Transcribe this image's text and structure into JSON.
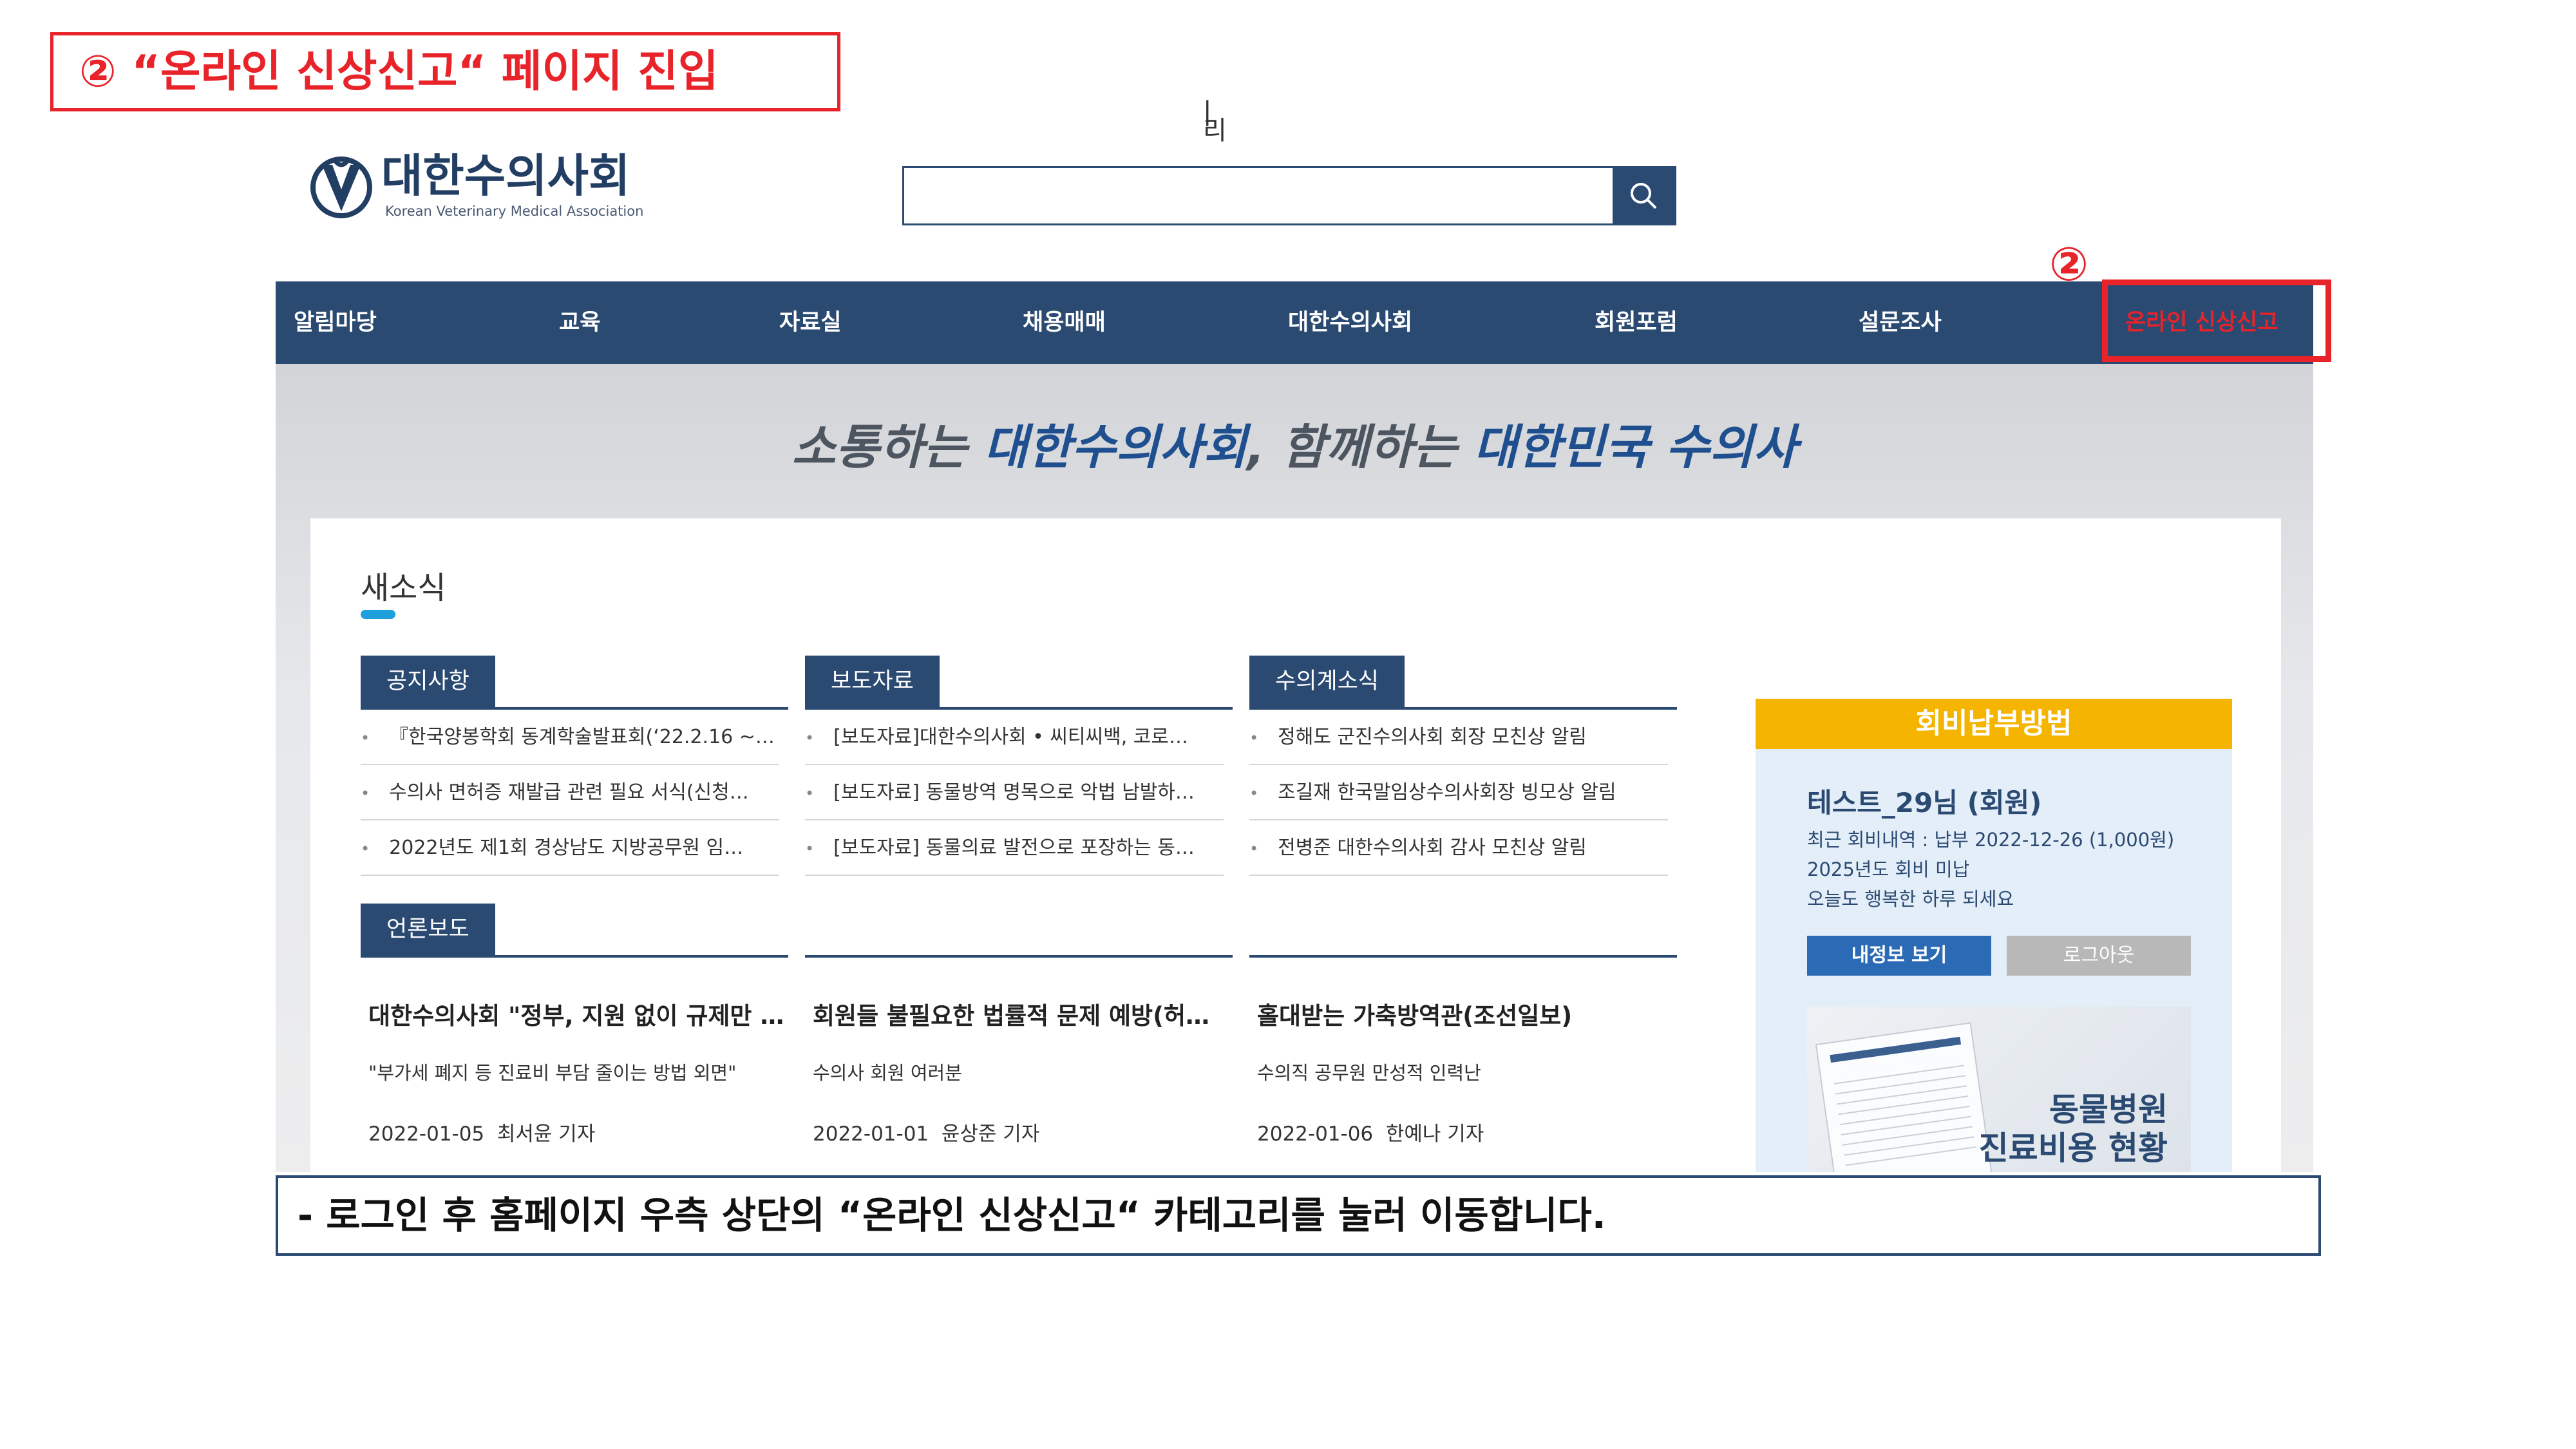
{
  "step_title": "② “온라인 신상신고“ 페이지 진입",
  "top_fragment": "| 리",
  "logo": {
    "name": "대한수의사회",
    "subtitle": "Korean Veterinary Medical Association"
  },
  "search": {
    "value": "",
    "placeholder": ""
  },
  "nav": {
    "items": [
      "알림마당",
      "교육",
      "자료실",
      "채용매매",
      "대한수의사회",
      "회원포럼",
      "설문조사",
      "온라인 신상신고"
    ],
    "highlight_label": "②"
  },
  "banner": {
    "slogan_part1": "소통하는 ",
    "slogan_hl1": "대한수의사회",
    "slogan_part2": ", 함께하는 ",
    "slogan_hl2": "대한민국 수의사"
  },
  "news": {
    "section_title": "새소식",
    "columns": [
      {
        "tab": "공지사항",
        "items": [
          "『한국양봉학회 동계학술발표회(‘22.2.16 ~…",
          "수의사 면허증 재발급 관련 필요 서식(신청…",
          "2022년도 제1회 경상남도 지방공무원 임…"
        ]
      },
      {
        "tab": "보도자료",
        "items": [
          "[보도자료]대한수의사회 • 씨티씨백, 코로…",
          "[보도자료] 동물방역 명목으로 악법 남발하…",
          "[보도자료] 동물의료 발전으로 포장하는 동…"
        ]
      },
      {
        "tab": "수의계소식",
        "items": [
          "정해도 군진수의사회 회장 모친상 알림",
          "조길재 한국말임상수의사회장 빙모상 알림",
          "전병준 대한수의사회 감사 모친상 알림"
        ]
      }
    ]
  },
  "press": {
    "tab": "언론보도",
    "articles": [
      {
        "title": "대한수의사회 \"정부, 지원 없이 규제만 해…",
        "sub": "\"부가세 폐지 등 진료비 부담 줄이는 방법 외면\"",
        "date": "2022-01-05",
        "reporter": "최서윤 기자"
      },
      {
        "title": "회원들 불필요한 법률적 문제 예방(허주형…",
        "sub": "수의사 회원 여러분",
        "date": "2022-01-01",
        "reporter": "윤상준 기자"
      },
      {
        "title": "홀대받는 가축방역관(조선일보)",
        "sub": "수의직 공무원 만성적 인력난",
        "date": "2022-01-06",
        "reporter": "한예나 기자"
      }
    ]
  },
  "fee": {
    "header": "회비납부방법",
    "user": "테스트_29님 (회원)",
    "lines": [
      "최근 회비내역 : 납부 2022-12-26 (1,000원)",
      "2025년도 회비 미납",
      "오늘도 행복한 하루 되세요"
    ],
    "btn_info": "내정보 보기",
    "btn_logout": "로그아웃",
    "promo_line1": "동물병원",
    "promo_line2": "진료비용 현황"
  },
  "caption": "- 로그인 후 홈페이지 우측 상단의 “온라인 신상신고“ 카테고리를 눌러 이동합니다.",
  "colors": {
    "navy": "#2b4a72",
    "red": "#e8232a",
    "gold": "#f5b400",
    "blue": "#2b6bb5",
    "accent": "#1ea0dc"
  }
}
